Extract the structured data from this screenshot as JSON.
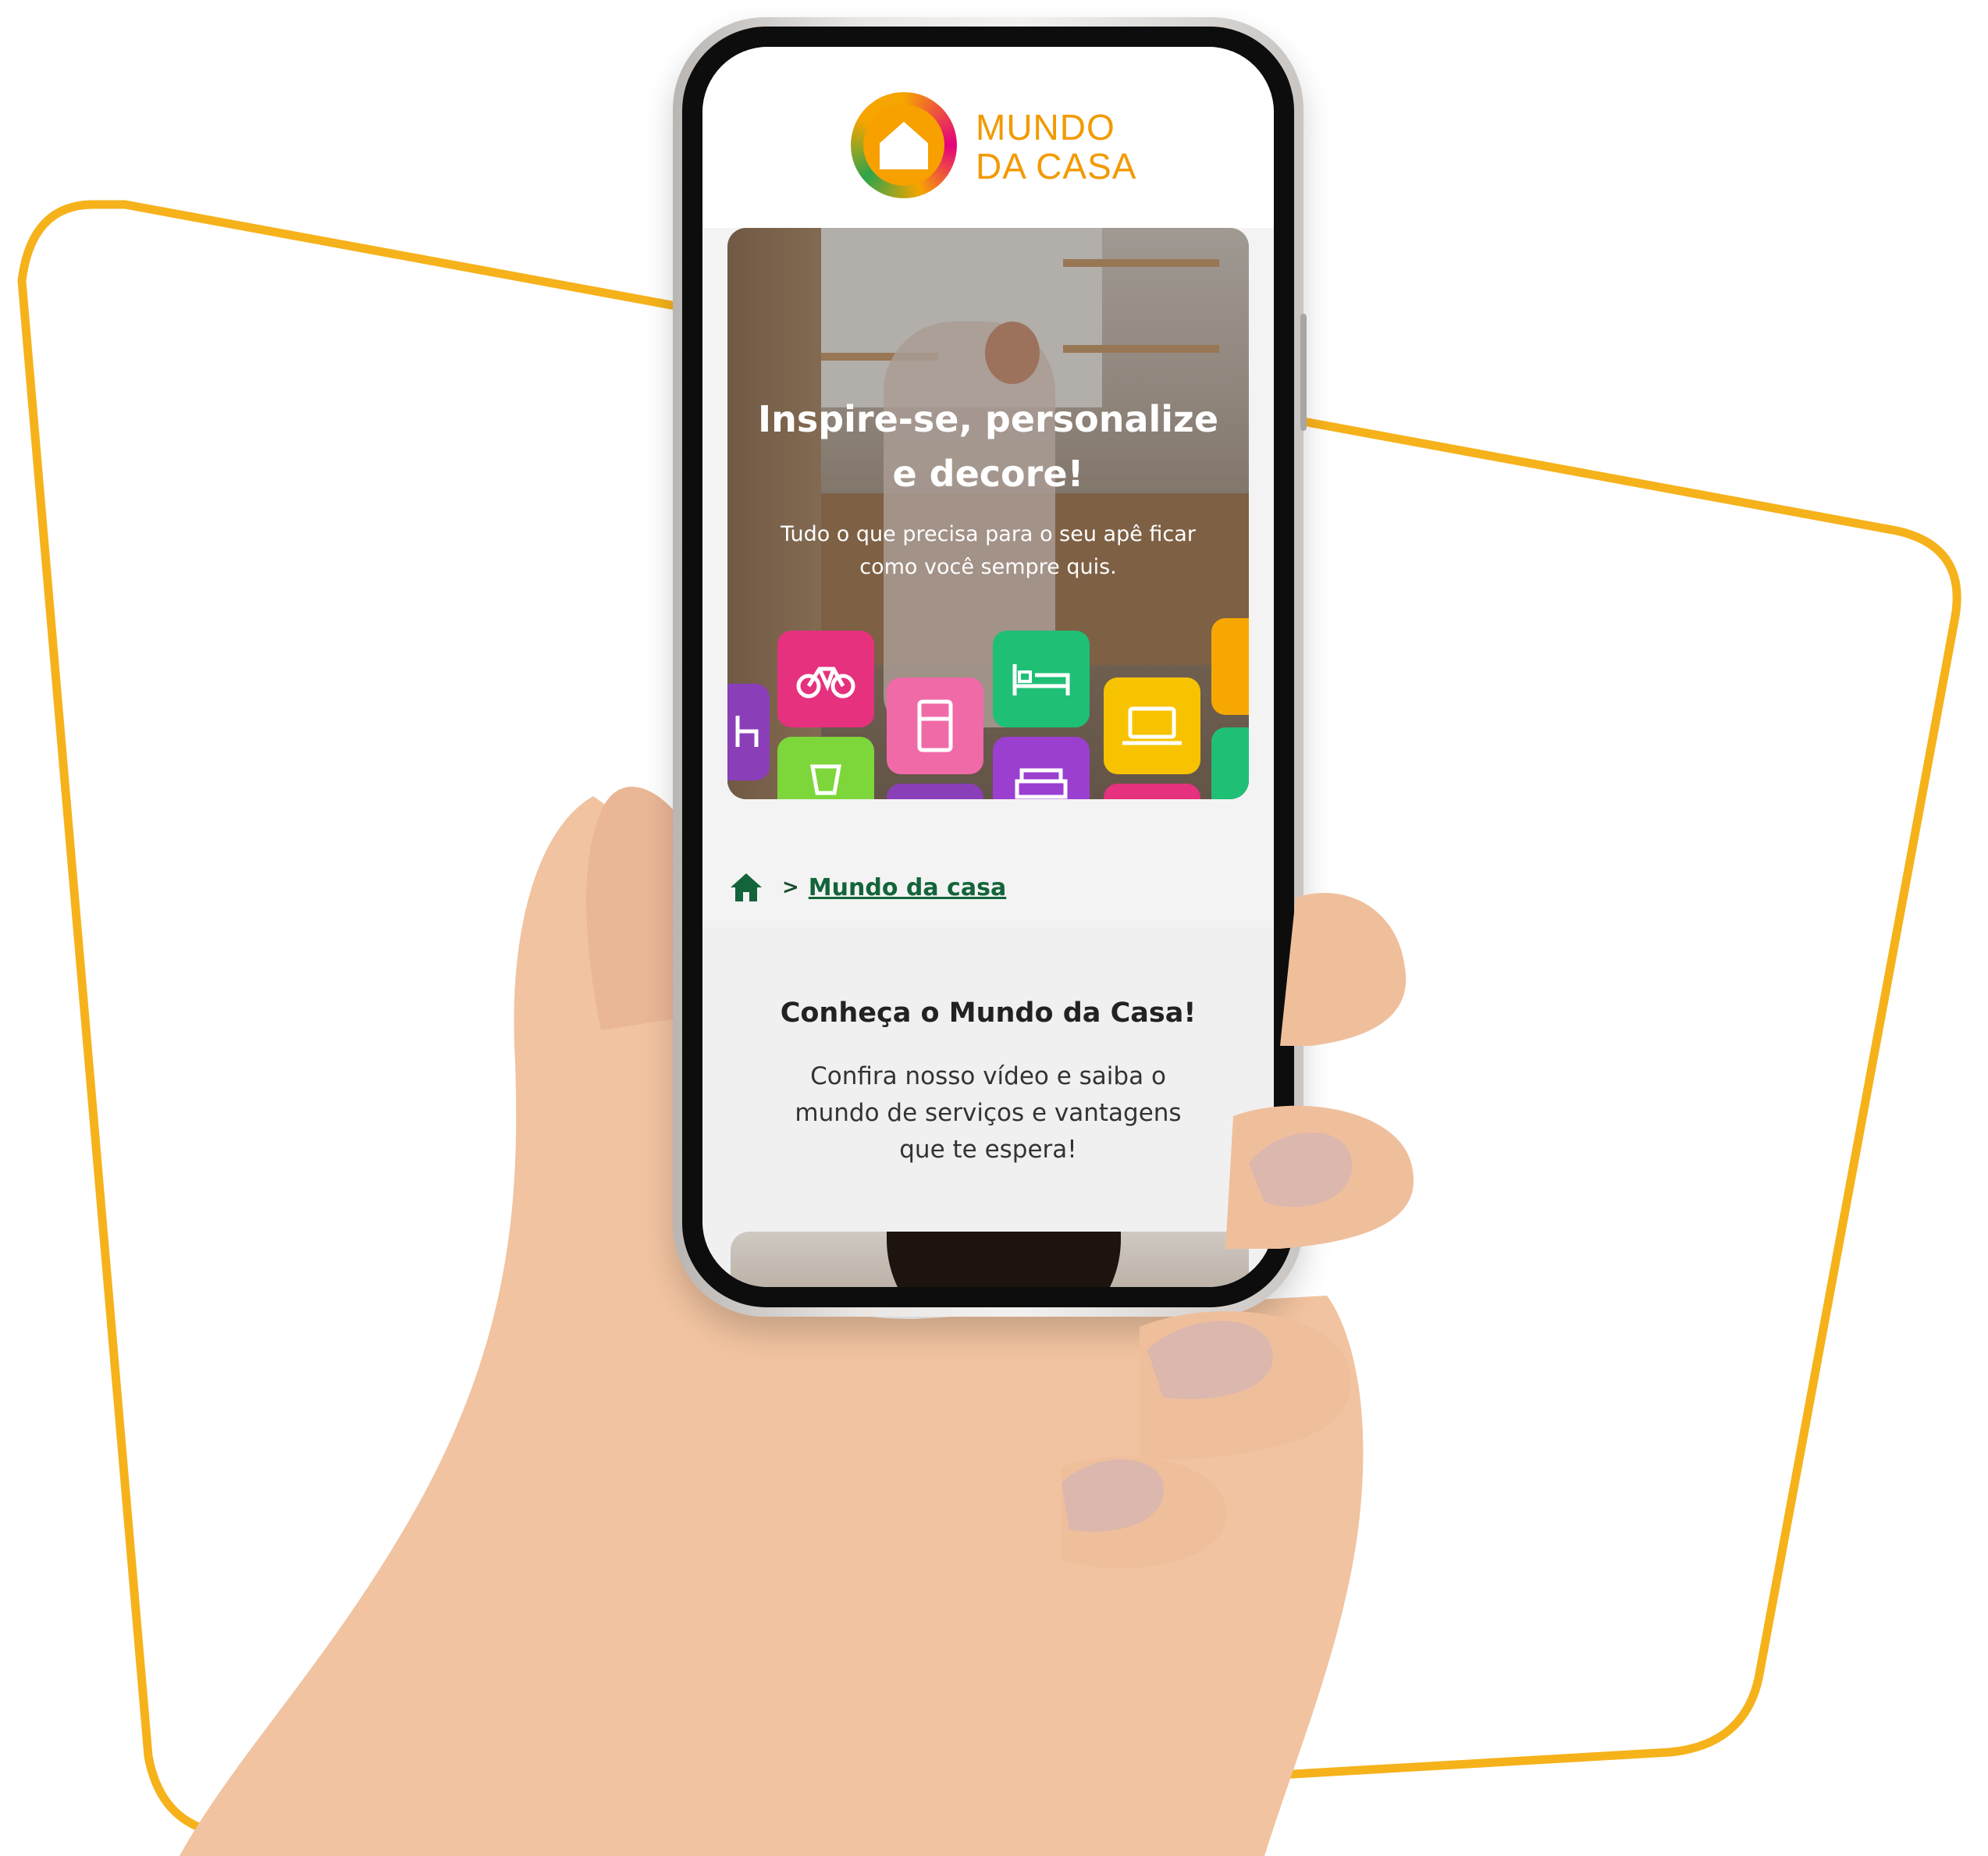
{
  "logo": {
    "line1": "MUNDO",
    "line2": "DA CASA",
    "text_color": "#f29a00"
  },
  "hero": {
    "title_line1": "Inspire-se, personalize",
    "title_line2": "e decore!",
    "subtitle_line1": "Tudo o que precisa para o seu apê ficar",
    "subtitle_line2": "como você sempre quis.",
    "tiles": [
      {
        "icon": "bicycle-icon",
        "color": "#e6317e"
      },
      {
        "icon": "bed-icon",
        "color": "#1fbf76"
      },
      {
        "icon": "refrigerator-icon",
        "color": "#f06aa8"
      },
      {
        "icon": "laptop-icon",
        "color": "#f7c300"
      },
      {
        "icon": "blender-icon",
        "color": "#7dd63a"
      },
      {
        "icon": "armchair-icon",
        "color": "#9b3fd0"
      },
      {
        "icon": "chair-icon",
        "color": "#8a3fb8"
      },
      {
        "icon": "stroller-icon",
        "color": "#f7a800"
      },
      {
        "icon": "plant-icon",
        "color": "#1fbf76"
      }
    ]
  },
  "breadcrumb": {
    "separator": ">",
    "current": "Mundo da casa",
    "color": "#13643a"
  },
  "intro": {
    "title": "Conheça o Mundo da Casa!",
    "text_line1": "Confira nosso vídeo e saiba o",
    "text_line2": "mundo de serviços e vantagens",
    "text_line3": "que te espera!"
  },
  "colors": {
    "frame_accent": "#f6b21b"
  }
}
